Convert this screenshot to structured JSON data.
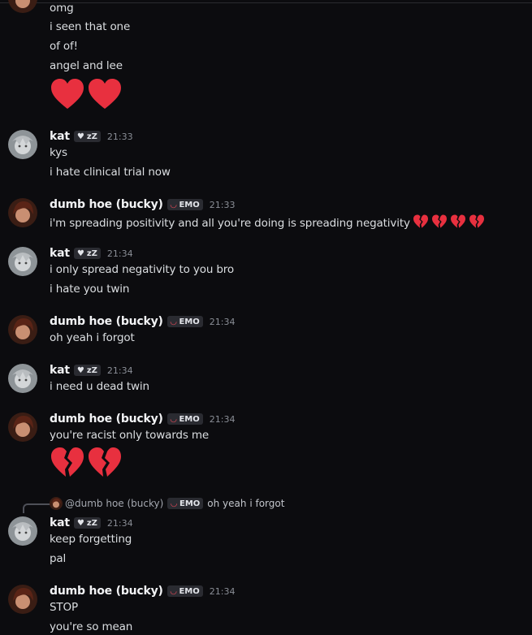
{
  "colors": {
    "background": "#0c0c0f",
    "heart": "#e8303f",
    "emo_accent": "#f04a5a"
  },
  "continuation": {
    "lines": [
      "omg",
      "i seen that one",
      "of of!",
      "angel and lee"
    ],
    "emojis": [
      "red-heart",
      "red-heart"
    ]
  },
  "users": {
    "kat": {
      "name": "kat",
      "badge": "zZ"
    },
    "bucky": {
      "name": "dumb hoe (bucky)",
      "badge": "EMO"
    }
  },
  "messages": [
    {
      "author": "kat",
      "time": "21:33",
      "lines": [
        "kys",
        "i hate clinical trial now"
      ]
    },
    {
      "author": "bucky",
      "time": "21:33",
      "lines": [
        "i'm spreading positivity and all you're doing is spreading negativity"
      ],
      "inline_emojis": [
        "broken-heart",
        "broken-heart",
        "broken-heart",
        "broken-heart"
      ]
    },
    {
      "author": "kat",
      "time": "21:34",
      "lines": [
        "i only spread negativity to you bro",
        "i hate you twin"
      ]
    },
    {
      "author": "bucky",
      "time": "21:34",
      "lines": [
        "oh yeah i forgot"
      ]
    },
    {
      "author": "kat",
      "time": "21:34",
      "lines": [
        "i need u dead twin"
      ]
    },
    {
      "author": "bucky",
      "time": "21:34",
      "lines": [
        "you're racist only towards me"
      ],
      "emojis": [
        "broken-heart",
        "broken-heart"
      ]
    },
    {
      "author": "kat",
      "time": "21:34",
      "reply": {
        "name": "@dumb hoe (bucky)",
        "badge": "EMO",
        "text": "oh yeah i forgot"
      },
      "lines": [
        "keep forgetting",
        "pal"
      ]
    },
    {
      "author": "bucky",
      "time": "21:34",
      "lines": [
        "STOP",
        "you're so mean"
      ]
    }
  ]
}
